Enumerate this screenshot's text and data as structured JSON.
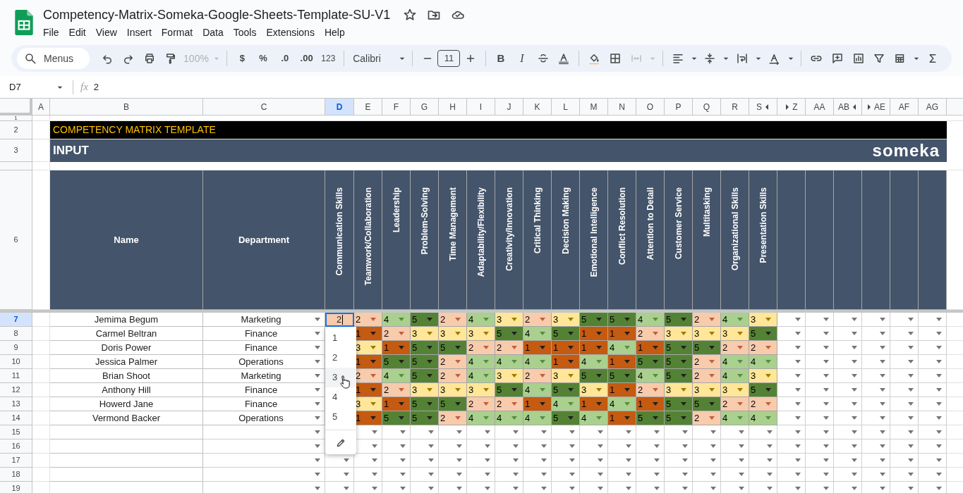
{
  "app": {
    "title": "Competency-Matrix-Someka-Google-Sheets-Template-SU-V1",
    "menus": [
      "File",
      "Edit",
      "View",
      "Insert",
      "Format",
      "Data",
      "Tools",
      "Extensions",
      "Help"
    ]
  },
  "toolbar": {
    "search_placeholder": "Menus",
    "zoom": "100%",
    "currency": "$",
    "percent": "%",
    "decrease_decimals": ".0",
    "increase_decimals": ".00",
    "number_format": "123",
    "font": "Calibri",
    "font_size": "11",
    "bold": "B",
    "italic": "I"
  },
  "formula_bar": {
    "cell_ref": "D7",
    "fx": "fx",
    "formula": "2"
  },
  "columns": [
    {
      "label": "A",
      "selected": false,
      "hidden_after": false
    },
    {
      "label": "B",
      "selected": false,
      "hidden_after": false
    },
    {
      "label": "C",
      "selected": false,
      "hidden_after": false
    },
    {
      "label": "D",
      "selected": true,
      "hidden_after": false
    },
    {
      "label": "E",
      "selected": false,
      "hidden_after": false
    },
    {
      "label": "F",
      "selected": false,
      "hidden_after": false
    },
    {
      "label": "G",
      "selected": false,
      "hidden_after": false
    },
    {
      "label": "H",
      "selected": false,
      "hidden_after": false
    },
    {
      "label": "I",
      "selected": false,
      "hidden_after": false
    },
    {
      "label": "J",
      "selected": false,
      "hidden_after": false
    },
    {
      "label": "K",
      "selected": false,
      "hidden_after": false
    },
    {
      "label": "L",
      "selected": false,
      "hidden_after": false
    },
    {
      "label": "M",
      "selected": false,
      "hidden_after": false
    },
    {
      "label": "N",
      "selected": false,
      "hidden_after": false
    },
    {
      "label": "O",
      "selected": false,
      "hidden_after": false
    },
    {
      "label": "P",
      "selected": false,
      "hidden_after": false
    },
    {
      "label": "Q",
      "selected": false,
      "hidden_after": false
    },
    {
      "label": "R",
      "selected": false,
      "hidden_after": false
    },
    {
      "label": "S",
      "selected": false,
      "hidden_after": true
    },
    {
      "label": "Z",
      "selected": false,
      "hidden_after": false
    },
    {
      "label": "AA",
      "selected": false,
      "hidden_after": false
    },
    {
      "label": "AB",
      "selected": false,
      "hidden_after": true
    },
    {
      "label": "AE",
      "selected": false,
      "hidden_after": false
    },
    {
      "label": "AF",
      "selected": false,
      "hidden_after": false
    },
    {
      "label": "AG",
      "selected": false,
      "hidden_after": false
    }
  ],
  "sheet": {
    "top_rows": [
      "1",
      "2",
      "3"
    ],
    "header_row": "6",
    "banner": "COMPETENCY MATRIX TEMPLATE",
    "section": "INPUT",
    "logo": "someka",
    "name_header": "Name",
    "department_header": "Department",
    "skills": [
      "Communication Skills",
      "Teamwork/Collaboration",
      "Leadership",
      "Problem-Solving",
      "Time Management",
      "Adaptability/Flexibility",
      "Creativity/Innovation",
      "Critical Thinking",
      "Decision Making",
      "Emotional Intelligence",
      "Conflict Resolution",
      "Attention to Detail",
      "Customer Service",
      "Multitasking",
      "Organizational Skills",
      "Presentation Skills"
    ],
    "active_cell_value": "2",
    "employees": [
      {
        "row": "7",
        "selected": true,
        "name": "Jemima Begum",
        "department": "Marketing",
        "scores": [
          "2",
          "4",
          "5",
          "2",
          "4",
          "3",
          "2",
          "3",
          "5",
          "5",
          "4",
          "5",
          "2",
          "4",
          "3"
        ]
      },
      {
        "row": "8",
        "selected": false,
        "name": "Carmel Beltran",
        "department": "Finance",
        "scores": [
          "1",
          "2",
          "3",
          "3",
          "3",
          "5",
          "4",
          "5",
          "1",
          "1",
          "2",
          "3",
          "3",
          "3",
          "5"
        ]
      },
      {
        "row": "9",
        "selected": false,
        "name": "Doris Power",
        "department": "Finance",
        "scores": [
          "3",
          "1",
          "5",
          "5",
          "2",
          "2",
          "1",
          "1",
          "1",
          "4",
          "1",
          "5",
          "5",
          "2",
          "2"
        ]
      },
      {
        "row": "10",
        "selected": false,
        "name": "Jessica Palmer",
        "department": "Operations",
        "scores": [
          "1",
          "5",
          "5",
          "2",
          "4",
          "4",
          "4",
          "1",
          "4",
          "1",
          "5",
          "5",
          "2",
          "4",
          "4"
        ]
      },
      {
        "row": "11",
        "selected": false,
        "name": "Brian Shoot",
        "department": "Marketing",
        "scores": [
          "2",
          "4",
          "5",
          "2",
          "4",
          "3",
          "2",
          "3",
          "5",
          "5",
          "4",
          "5",
          "2",
          "4",
          "3"
        ]
      },
      {
        "row": "12",
        "selected": false,
        "name": "Anthony Hill",
        "department": "Finance",
        "scores": [
          "1",
          "2",
          "3",
          "3",
          "3",
          "5",
          "4",
          "5",
          "3",
          "1",
          "2",
          "3",
          "3",
          "3",
          "5"
        ]
      },
      {
        "row": "13",
        "selected": false,
        "name": "Howerd Jane",
        "department": "Finance",
        "scores": [
          "3",
          "1",
          "5",
          "5",
          "2",
          "2",
          "1",
          "4",
          "1",
          "4",
          "1",
          "5",
          "5",
          "2",
          "2"
        ]
      },
      {
        "row": "14",
        "selected": false,
        "name": "Vermond Backer",
        "department": "Operations",
        "scores": [
          "1",
          "5",
          "5",
          "2",
          "4",
          "4",
          "4",
          "5",
          "4",
          "1",
          "5",
          "5",
          "2",
          "4",
          "4"
        ]
      }
    ],
    "empty_rows": [
      "15",
      "16",
      "17",
      "18",
      "19"
    ]
  },
  "dropdown": {
    "options": [
      {
        "label": "1",
        "hovered": false
      },
      {
        "label": "2",
        "hovered": false
      },
      {
        "label": "3",
        "hovered": true
      },
      {
        "label": "4",
        "hovered": false
      },
      {
        "label": "5",
        "hovered": false
      }
    ]
  }
}
